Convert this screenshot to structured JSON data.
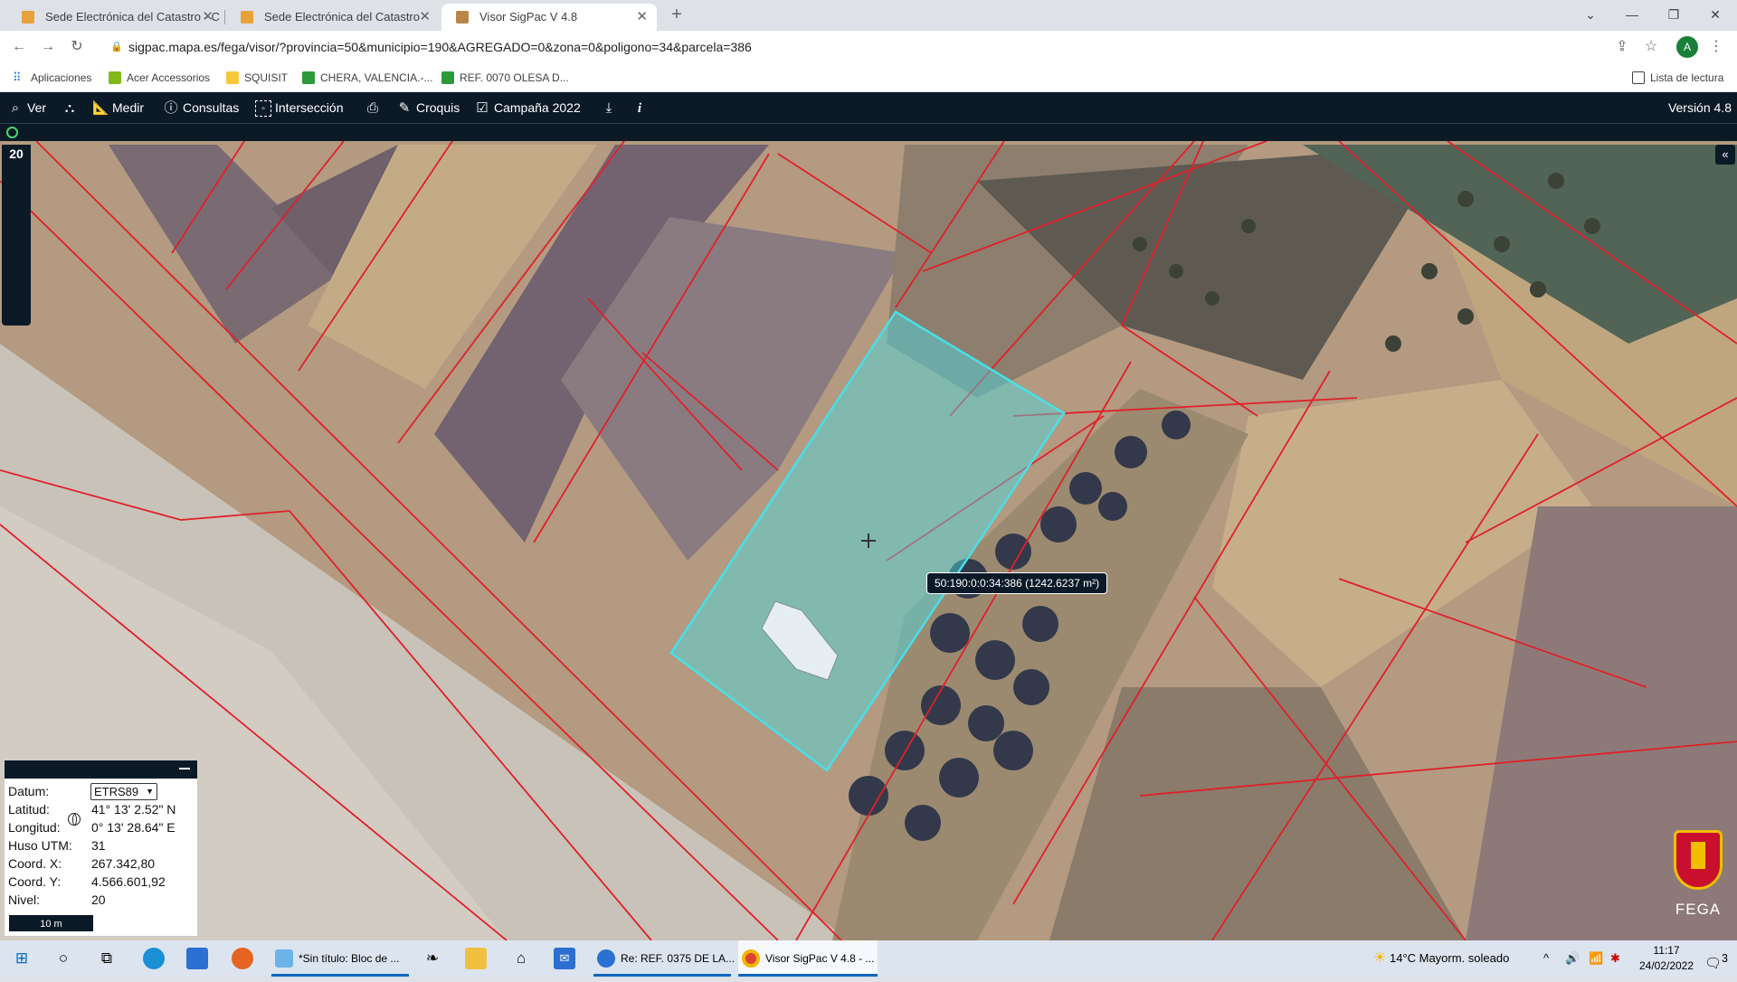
{
  "browser": {
    "tabs": [
      {
        "title": "Sede Electrónica del Catastro - C",
        "active": false
      },
      {
        "title": "Sede Electrónica del Catastro",
        "active": false
      },
      {
        "title": "Visor SigPac V 4.8",
        "active": true
      }
    ],
    "new_tab": "+",
    "url": "sigpac.mapa.es/fega/visor/?provincia=50&municipio=190&AGREGADO=0&zona=0&poligono=34&parcela=386",
    "profile_letter": "A",
    "bookmarks": [
      "Aplicaciones",
      "Acer Accessorios",
      "SQUISIT",
      "CHERA, VALENCIA.-...",
      "REF. 0070 OLESA D..."
    ],
    "reading_list": "Lista de lectura"
  },
  "toolbar": {
    "items": [
      {
        "label": "Ver",
        "icon": "search-icon"
      },
      {
        "label": "",
        "icon": "binoculars-icon"
      },
      {
        "label": "Medir",
        "icon": "ruler-icon"
      },
      {
        "label": "Consultas",
        "icon": "info-circle-icon"
      },
      {
        "label": "Intersección",
        "icon": "intersection-icon"
      },
      {
        "label": "",
        "icon": "printer-icon"
      },
      {
        "label": "Croquis",
        "icon": "pencil-icon"
      },
      {
        "label": "Campaña 2022",
        "icon": "calendar-check-icon"
      },
      {
        "label": "",
        "icon": "download-icon"
      },
      {
        "label": "",
        "icon": "info-icon"
      }
    ],
    "version": "Versión 4.8"
  },
  "map": {
    "zoom_level": "20",
    "parcel_label": "50:190:0:0:34:386 (1242.6237 m²)",
    "highlight_color": "#48e0e8",
    "boundary_color": "#e0202a"
  },
  "coords": {
    "datum_label": "Datum:",
    "datum_value": "ETRS89",
    "lat_label": "Latitud:",
    "lat_value": "41° 13' 2.52\" N",
    "lon_label": "Longitud:",
    "lon_value": "0° 13' 28.64\" E",
    "huso_label": "Huso UTM:",
    "huso_value": "31",
    "x_label": "Coord. X:",
    "x_value": "267.342,80",
    "y_label": "Coord. Y:",
    "y_value": "4.566.601,92",
    "nivel_label": "Nivel:",
    "nivel_value": "20",
    "scale": "10 m"
  },
  "logo": {
    "label": "FEGA"
  },
  "taskbar": {
    "apps": [
      {
        "label": "*Sin título: Bloc de ...",
        "icon": "notepad-icon"
      },
      {
        "label": "Re: REF. 0375 DE LA...",
        "icon": "thunderbird-icon"
      },
      {
        "label": "Visor SigPac V 4.8 - ...",
        "icon": "chrome-icon"
      }
    ],
    "weather": "14°C  Mayorm. soleado",
    "time": "11:17",
    "date": "24/02/2022",
    "notif_count": "3"
  }
}
